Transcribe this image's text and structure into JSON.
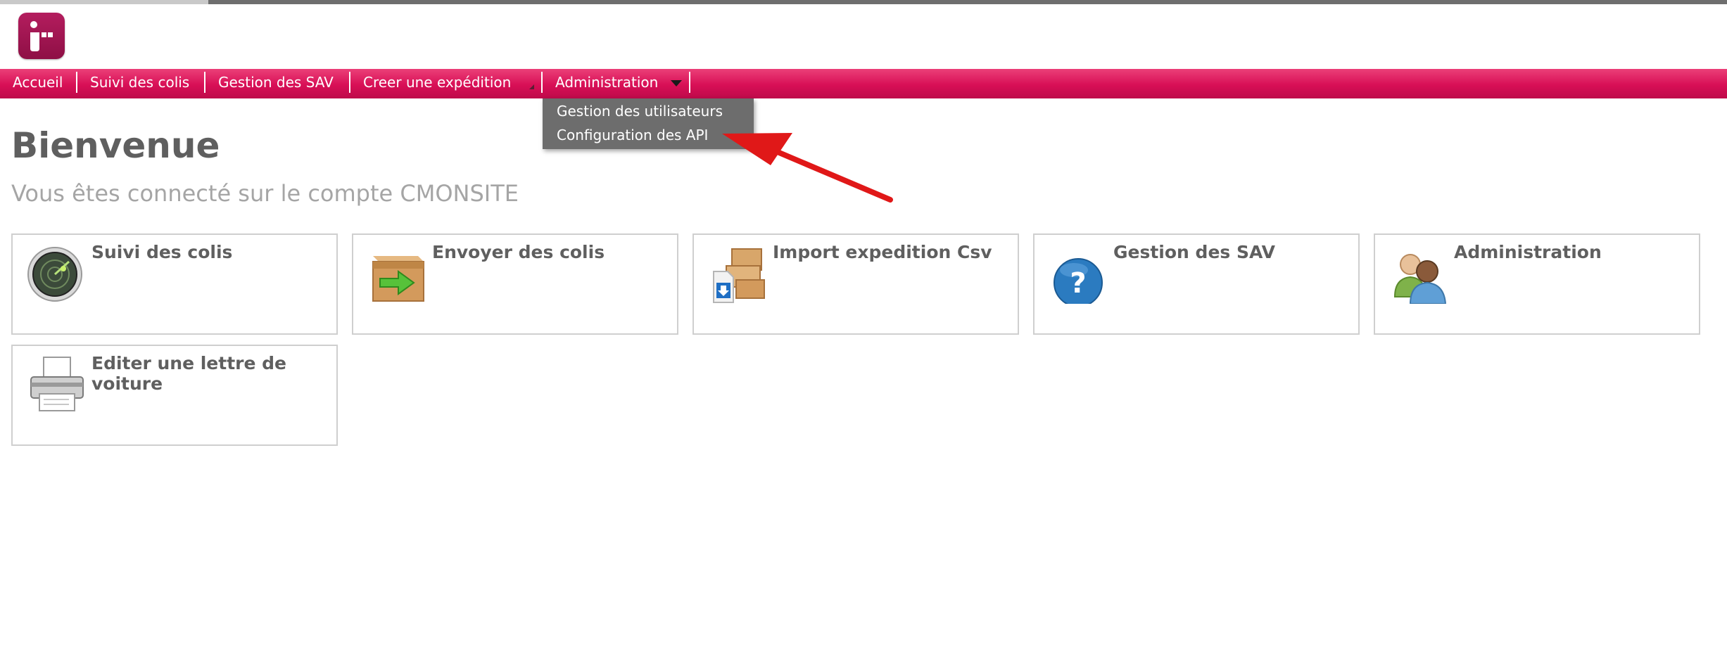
{
  "app": {
    "logo_letter": "r"
  },
  "nav": {
    "items": [
      {
        "label": "Accueil"
      },
      {
        "label": "Suivi des colis"
      },
      {
        "label": "Gestion des SAV"
      },
      {
        "label": "Creer une expédition"
      },
      {
        "label": "Administration"
      }
    ],
    "active": "Administration"
  },
  "dropdown": {
    "items": [
      {
        "label": "Gestion des utilisateurs"
      },
      {
        "label": "Configuration des API"
      }
    ]
  },
  "main": {
    "title": "Bienvenue",
    "subtitle": "Vous êtes connecté sur le compte CMONSITE",
    "tiles": [
      {
        "label": "Suivi des colis",
        "icon": "radar-icon"
      },
      {
        "label": "Envoyer des colis",
        "icon": "shipping-box-icon"
      },
      {
        "label": "Import expedition Csv",
        "icon": "import-boxes-icon"
      },
      {
        "label": "Gestion des SAV",
        "icon": "help-icon"
      },
      {
        "label": "Administration",
        "icon": "users-icon"
      },
      {
        "label": "Editer une lettre de voiture",
        "icon": "printer-icon"
      }
    ]
  },
  "colors": {
    "brand": "#d80f56",
    "dropdown_bg": "#6d6d6d",
    "annotation_arrow": "#e01818"
  }
}
